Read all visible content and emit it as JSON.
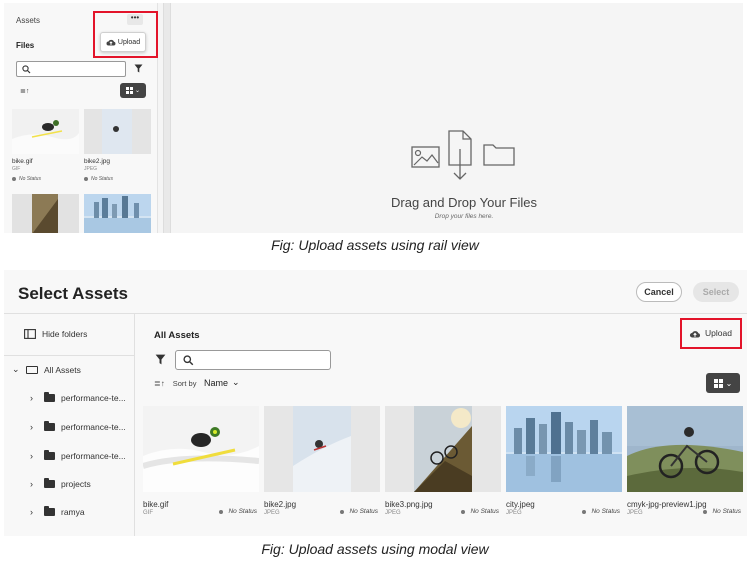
{
  "rail": {
    "title": "Assets",
    "more_label": "•••",
    "upload_label": "Upload",
    "files_label": "Files",
    "sort_icon_label": "≣↑",
    "thumbs": [
      {
        "name": "bike.gif",
        "type": "GIF",
        "status": "No Status"
      },
      {
        "name": "bike2.jpg",
        "type": "JPEG",
        "status": "No Status"
      }
    ],
    "drop_title": "Drag and Drop Your Files",
    "drop_subtitle": "Drop your files here."
  },
  "caption_top": "Fig: Upload assets using rail view",
  "modal": {
    "title": "Select Assets",
    "cancel_label": "Cancel",
    "select_label": "Select",
    "hide_folders_label": "Hide folders",
    "tree": [
      {
        "label": "All Assets"
      },
      {
        "label": "performance-te..."
      },
      {
        "label": "performance-te..."
      },
      {
        "label": "performance-te..."
      },
      {
        "label": "projects"
      },
      {
        "label": "ramya"
      }
    ],
    "main_title": "All Assets",
    "upload_label": "Upload",
    "sort_icon_label": "≣↑",
    "sort_by_label": "Sort by",
    "sort_value": "Name",
    "cards": [
      {
        "name": "bike.gif",
        "type": "GIF",
        "status": "No Status"
      },
      {
        "name": "bike2.jpg",
        "type": "JPEG",
        "status": "No Status"
      },
      {
        "name": "bike3.png.jpg",
        "type": "JPEG",
        "status": "No Status"
      },
      {
        "name": "city.jpeg",
        "type": "JPEG",
        "status": "No Status"
      },
      {
        "name": "cmyk-jpg-preview1.jpg",
        "type": "JPEG",
        "status": "No Status"
      }
    ]
  },
  "caption_bottom": "Fig: Upload assets using modal view",
  "colors": {
    "highlight": "#e3142a",
    "status_dot": "#777777",
    "dark_button": "#444444"
  }
}
